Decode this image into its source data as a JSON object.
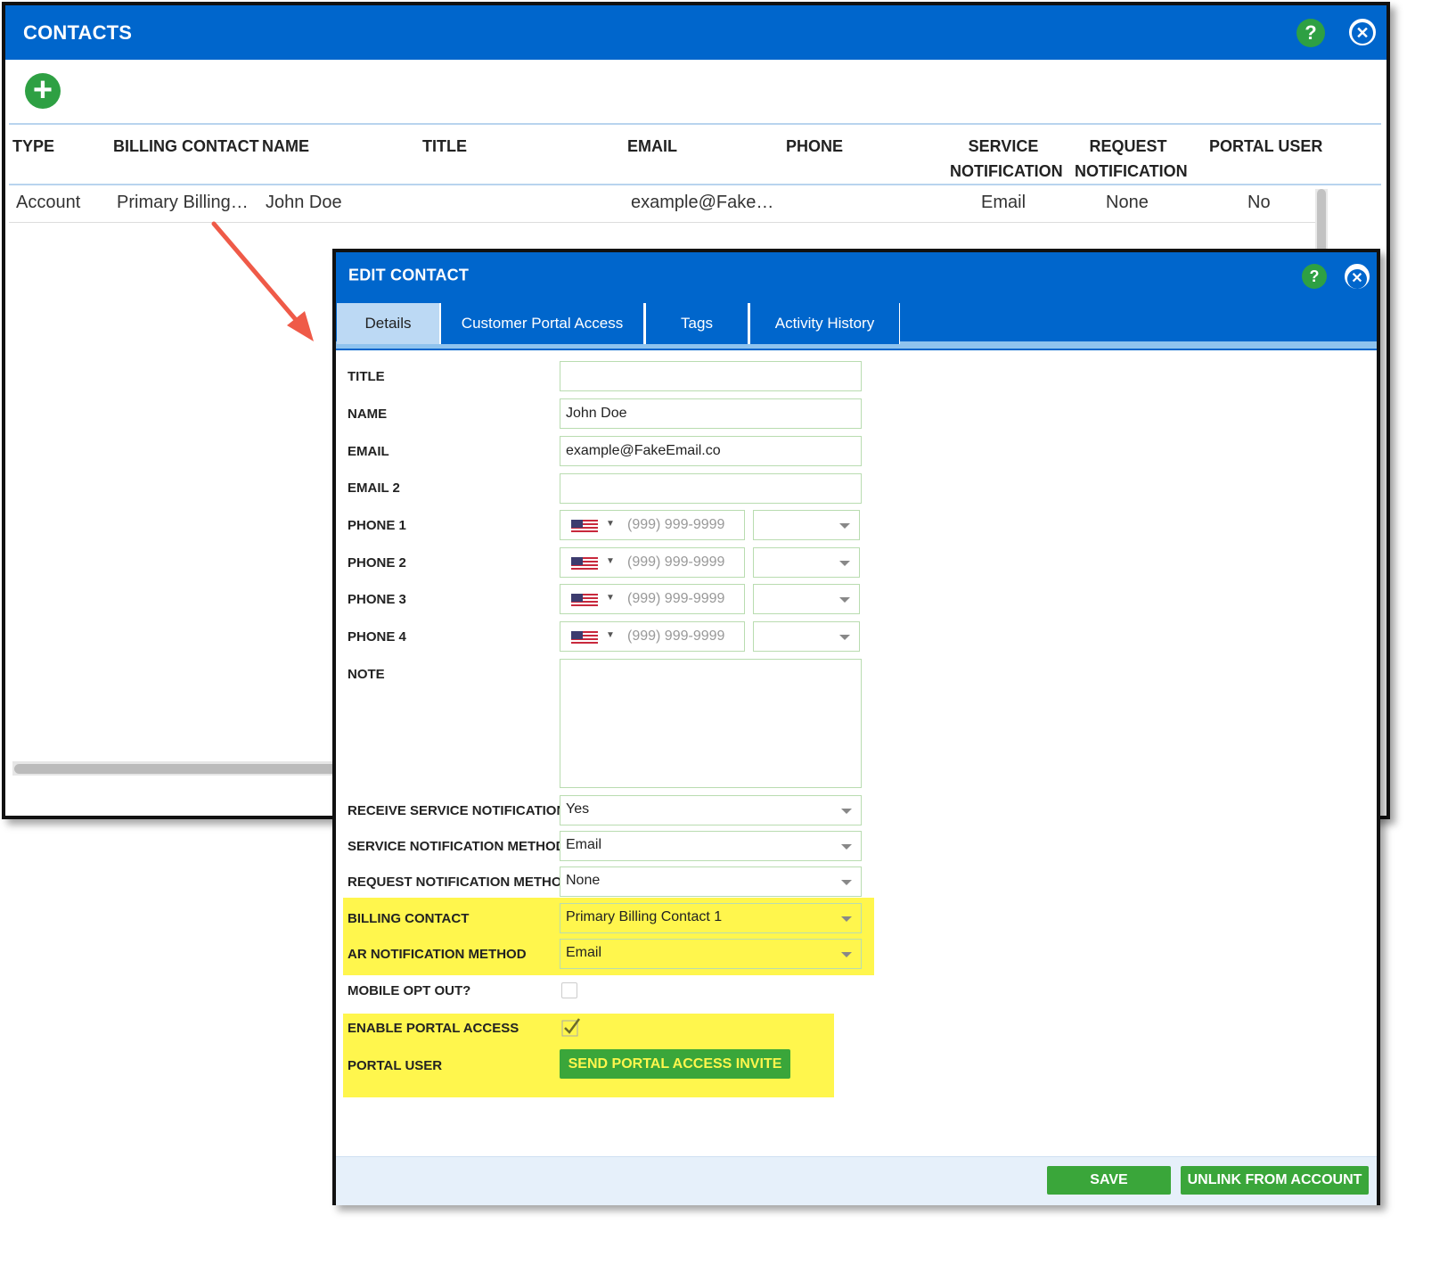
{
  "contacts": {
    "title": "CONTACTS",
    "help_icon": "?",
    "close_icon": "✕",
    "add_icon": "+",
    "columns": [
      "TYPE",
      "BILLING CONTACT",
      "NAME",
      "TITLE",
      "EMAIL",
      "PHONE",
      "SERVICE\nNOTIFICATION",
      "REQUEST\nNOTIFICATION",
      "PORTAL USER"
    ],
    "rows": [
      {
        "type": "Account",
        "billing_contact": "Primary Billing…",
        "name": "John Doe",
        "title": "",
        "email": "example@Fake…",
        "phone": "",
        "service_notification": "Email",
        "request_notification": "None",
        "portal_user": "No"
      }
    ]
  },
  "edit_contact": {
    "title": "EDIT CONTACT",
    "help_icon": "?",
    "close_icon": "✕",
    "tabs": [
      "Details",
      "Customer Portal Access",
      "Tags",
      "Activity History"
    ],
    "active_tab": "Details",
    "fields": {
      "title": {
        "label": "TITLE",
        "value": ""
      },
      "name": {
        "label": "NAME",
        "value": "John Doe"
      },
      "email": {
        "label": "EMAIL",
        "value": "example@FakeEmail.co"
      },
      "email2": {
        "label": "EMAIL 2",
        "value": ""
      },
      "phone1": {
        "label": "PHONE 1",
        "placeholder": "(999) 999-9999"
      },
      "phone2": {
        "label": "PHONE 2",
        "placeholder": "(999) 999-9999"
      },
      "phone3": {
        "label": "PHONE 3",
        "placeholder": "(999) 999-9999"
      },
      "phone4": {
        "label": "PHONE 4",
        "placeholder": "(999) 999-9999"
      },
      "note": {
        "label": "NOTE",
        "value": ""
      },
      "receive_service_notifications": {
        "label": "RECEIVE SERVICE NOTIFICATIONS",
        "value": "Yes"
      },
      "service_notification_method": {
        "label": "SERVICE NOTIFICATION METHOD",
        "value": "Email"
      },
      "request_notification_method": {
        "label": "REQUEST NOTIFICATION METHOD",
        "value": "None"
      },
      "billing_contact": {
        "label": "BILLING CONTACT",
        "value": "Primary Billing Contact 1"
      },
      "ar_notification_method": {
        "label": "AR NOTIFICATION METHOD",
        "value": "Email"
      },
      "mobile_opt_out": {
        "label": "MOBILE OPT OUT?",
        "checked": false
      },
      "enable_portal_access": {
        "label": "ENABLE PORTAL ACCESS",
        "checked": true
      },
      "portal_user": {
        "label": "PORTAL USER",
        "button": "SEND PORTAL ACCESS INVITE"
      }
    },
    "footer": {
      "save": "SAVE",
      "unlink": "UNLINK FROM ACCOUNT"
    }
  },
  "colors": {
    "header_blue": "#0066cc",
    "green": "#2ea043",
    "highlight_yellow": "#fff64d",
    "arrow_red": "#ef5a48"
  }
}
